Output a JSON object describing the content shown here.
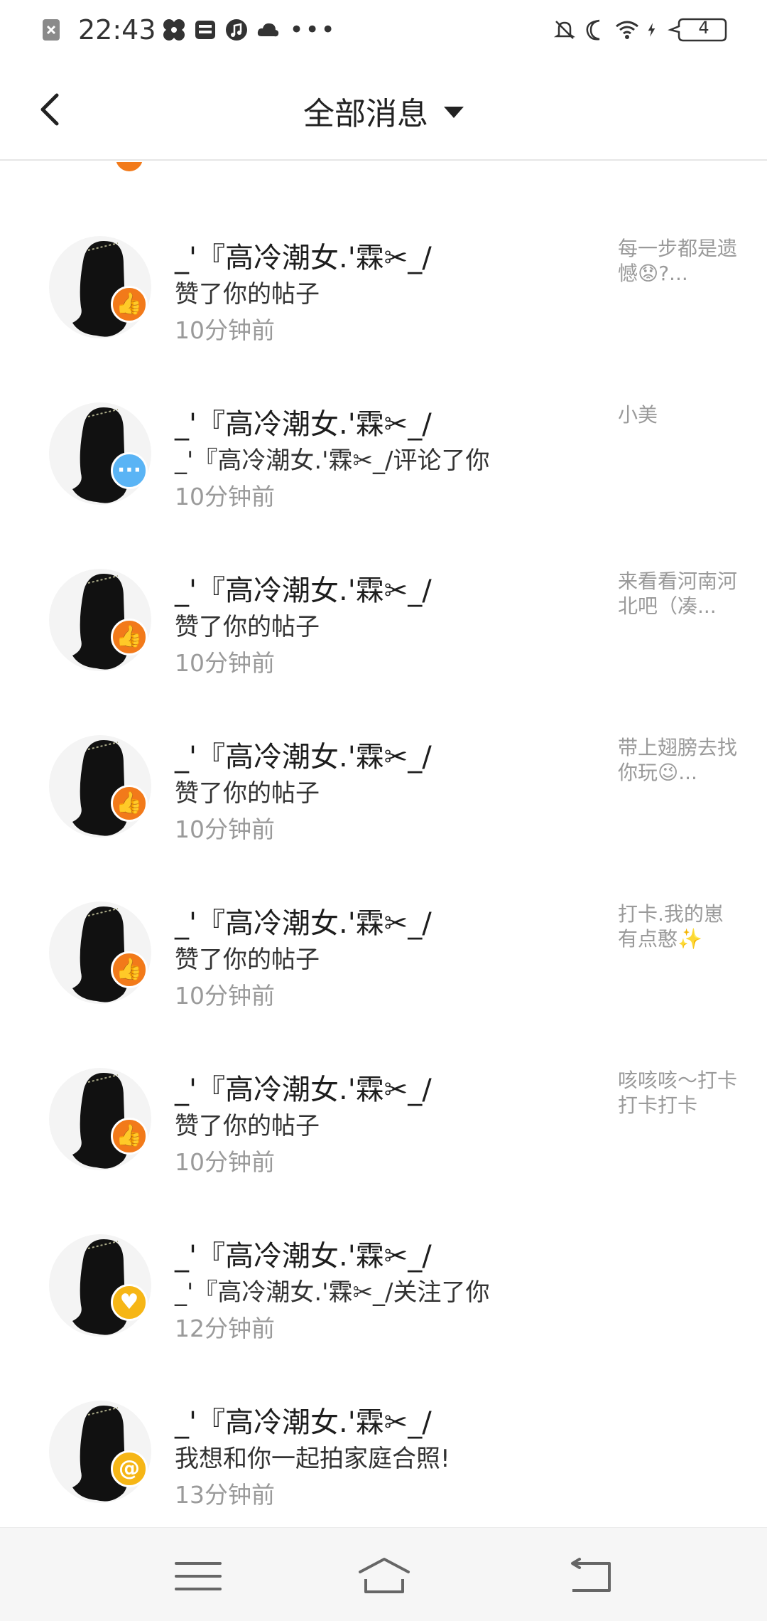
{
  "status": {
    "time": "22:43",
    "battery": "4"
  },
  "header": {
    "title": "全部消息"
  },
  "notifications": [
    {
      "name": "_'『高冷潮女.'霖✂_/",
      "action": "赞了你的帖子",
      "time": "10分钟前",
      "preview": "每一步都是遗憾😟?...",
      "badge": "like"
    },
    {
      "name": "_'『高冷潮女.'霖✂_/",
      "action": "_'『高冷潮女.'霖✂_/评论了你",
      "time": "10分钟前",
      "preview": "小美",
      "badge": "comment"
    },
    {
      "name": "_'『高冷潮女.'霖✂_/",
      "action": "赞了你的帖子",
      "time": "10分钟前",
      "preview": "来看看河南河北吧（凑...",
      "badge": "like"
    },
    {
      "name": "_'『高冷潮女.'霖✂_/",
      "action": "赞了你的帖子",
      "time": "10分钟前",
      "preview": "带上翅膀去找你玩😉...",
      "badge": "like"
    },
    {
      "name": "_'『高冷潮女.'霖✂_/",
      "action": "赞了你的帖子",
      "time": "10分钟前",
      "preview": "打卡.我的崽有点憨✨",
      "badge": "like"
    },
    {
      "name": "_'『高冷潮女.'霖✂_/",
      "action": "赞了你的帖子",
      "time": "10分钟前",
      "preview": "咳咳咳～打卡打卡打卡",
      "badge": "like"
    },
    {
      "name": "_'『高冷潮女.'霖✂_/",
      "action": "_'『高冷潮女.'霖✂_/关注了你",
      "time": "12分钟前",
      "preview": "",
      "badge": "follow"
    },
    {
      "name": "_'『高冷潮女.'霖✂_/",
      "action": "我想和你一起拍家庭合照!",
      "time": "13分钟前",
      "preview": "",
      "badge": "at"
    }
  ],
  "icons": {
    "back": "chevron-left-icon",
    "menu": "menu-icon",
    "home": "home-icon",
    "return": "return-icon"
  },
  "colors": {
    "like_badge": "#f27a1a",
    "comment_badge": "#5ab4f5",
    "follow_badge": "#f6b616"
  }
}
